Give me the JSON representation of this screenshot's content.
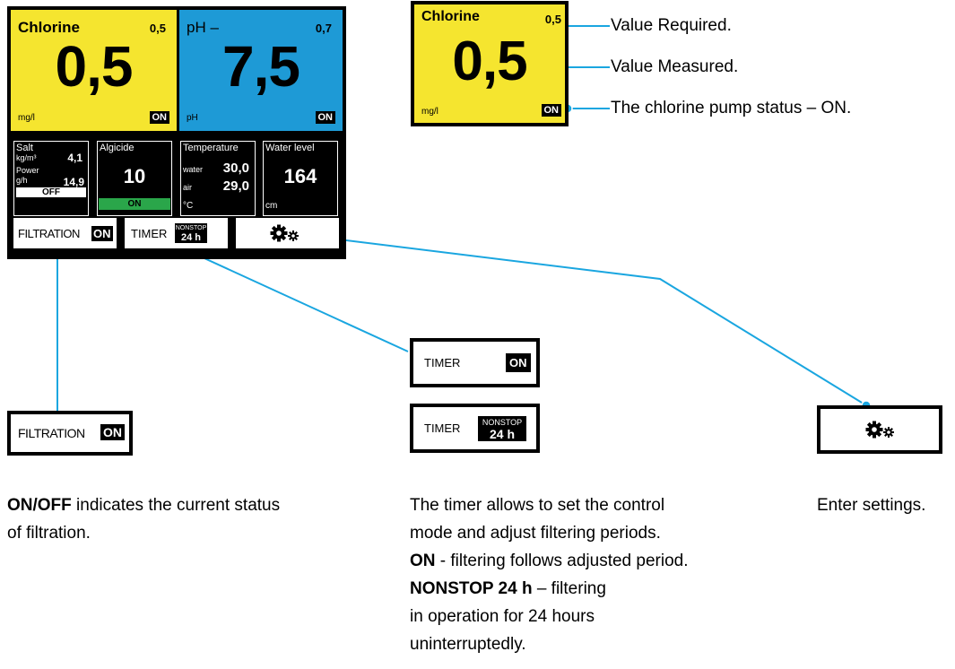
{
  "panel": {
    "chlorine": {
      "label": "Chlorine",
      "required": "0,5",
      "value": "0,5",
      "unit": "mg/l",
      "status": "ON"
    },
    "ph": {
      "label": "pH –",
      "required": "0,7",
      "value": "7,5",
      "unit": "pH",
      "status": "ON"
    },
    "salt": {
      "label": "Salt",
      "sub1": "kg/m³",
      "val1": "4,1",
      "sub2": "Power",
      "sub3": "g/h",
      "val2": "14,9",
      "status": "OFF"
    },
    "algicide": {
      "label": "Algicide",
      "value": "10",
      "status": "ON"
    },
    "temperature": {
      "label": "Temperature",
      "water_label": "water",
      "water_value": "30,0",
      "air_label": "air",
      "air_value": "29,0",
      "unit": "°C"
    },
    "water_level": {
      "label": "Water level",
      "value": "164",
      "unit": "cm"
    },
    "filtration": {
      "label": "FILTRATION",
      "status": "ON"
    },
    "timer": {
      "label": "TIMER",
      "badge_top": "NONSTOP",
      "badge_bottom": "24 h"
    }
  },
  "zoom_tile": {
    "label": "Chlorine",
    "required": "0,5",
    "value": "0,5",
    "unit": "mg/l",
    "status": "ON"
  },
  "callouts": {
    "required": "Value Required.",
    "measured": "Value Measured.",
    "pump": "The chlorine pump status – ON."
  },
  "examples": {
    "timer_on": {
      "label": "TIMER",
      "status": "ON"
    },
    "timer_nonstop": {
      "label": "TIMER",
      "badge_top": "NONSTOP",
      "badge_bottom": "24 h"
    },
    "filtration": {
      "label": "FILTRATION",
      "status": "ON"
    }
  },
  "descriptions": {
    "filtration": {
      "bold1": "ON",
      "slash": "/",
      "bold2": "OFF",
      "rest": " indicates the current status",
      "line2": "of filtration."
    },
    "timer": {
      "line1": "The timer allows to set the control",
      "line2": "mode and adjust filtering periods.",
      "line3_bold": "ON",
      "line3_rest": " - filtering follows adjusted period.",
      "line4_bold": "NONSTOP 24 h",
      "line4_rest": " – filtering",
      "line5": "in operation for 24 hours",
      "line6": "uninterruptedly."
    },
    "settings": "Enter settings."
  },
  "colors": {
    "yellow": "#f5e52f",
    "blue": "#1e9ad6",
    "green": "#2aa64a",
    "accent_line": "#1aa6e0"
  },
  "icons": {
    "settings": "gears-icon"
  }
}
